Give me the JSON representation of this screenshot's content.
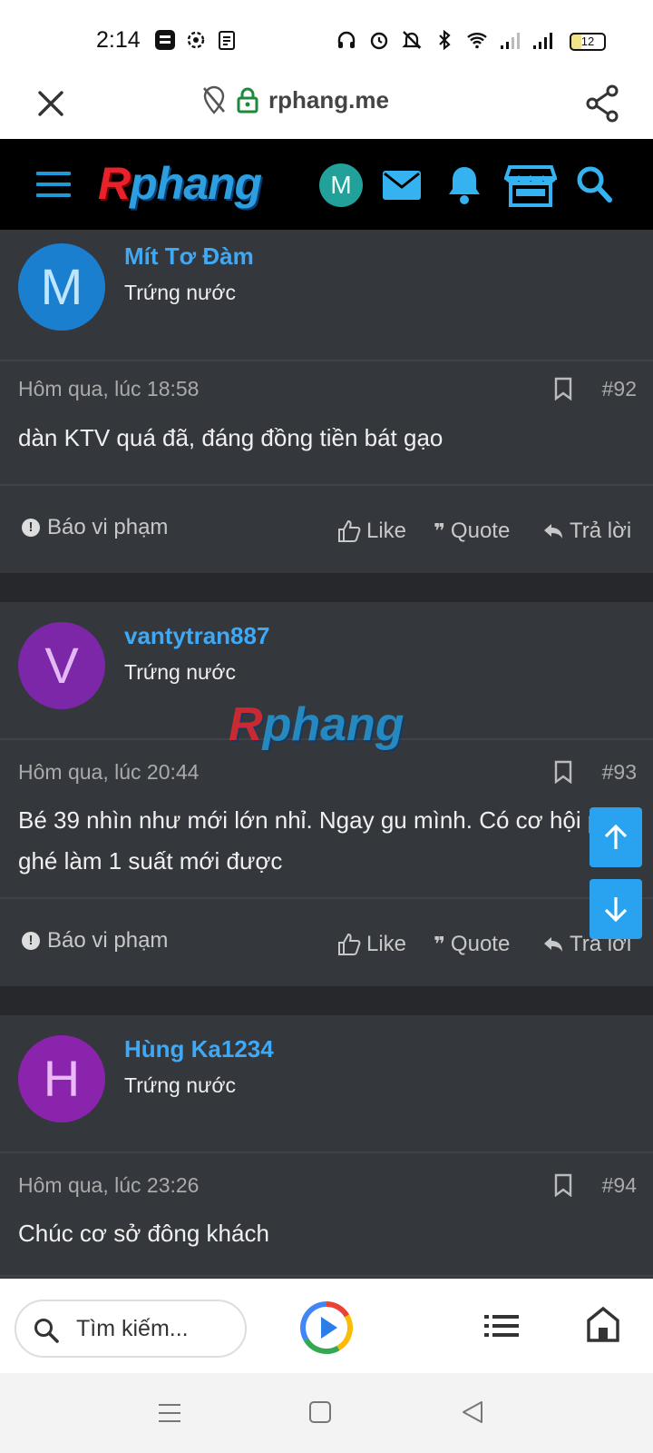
{
  "status_bar": {
    "time": "2:14",
    "battery": "12"
  },
  "browser": {
    "url": "rphang.me",
    "search_placeholder": "Tìm kiếm..."
  },
  "site": {
    "logo_r": "R",
    "logo_rest": "phang",
    "user_initial": "M"
  },
  "watermark": {
    "r": "R",
    "rest": "phang"
  },
  "actions": {
    "report": "Báo vi phạm",
    "like": "Like",
    "quote": "Quote",
    "reply": "Trả lời"
  },
  "posts": [
    {
      "initial": "M",
      "name": "Mít Tơ Đàm",
      "title": "Trứng nước",
      "date": "Hôm qua, lúc 18:58",
      "number": "#92",
      "text": "dàn KTV quá đã, đáng đồng tiền bát gạo",
      "avatar_color": "#1a7fcf",
      "avatar_text_color": "#bfe6ff"
    },
    {
      "initial": "V",
      "name": "vantytran887",
      "title": "Trứng nước",
      "date": "Hôm qua, lúc 20:44",
      "number": "#93",
      "text": "Bé 39 nhìn như mới lớn nhỉ. Ngay gu mình. Có cơ hội phải ghé làm 1 suất mới được",
      "avatar_color": "#7b27a8",
      "avatar_text_color": "#e2b9f5"
    },
    {
      "initial": "H",
      "name": "Hùng Ka1234",
      "title": "Trứng nước",
      "date": "Hôm qua, lúc 23:26",
      "number": "#94",
      "text": "Chúc cơ sở đông khách",
      "avatar_color": "#8a24ad",
      "avatar_text_color": "#eab8f7"
    }
  ]
}
